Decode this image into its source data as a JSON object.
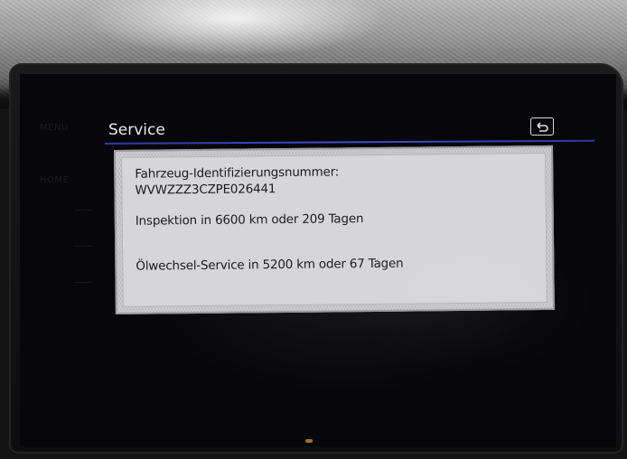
{
  "softkeys": {
    "menu": "MENU",
    "home": "HOME"
  },
  "header": {
    "title": "Service",
    "back_icon": "back-arrow-icon"
  },
  "service_info": {
    "vin_label": "Fahrzeug-Identifizierungsnummer:",
    "vin_value": "WVWZZZ3CZPE026441",
    "inspection": "Inspektion in 6600 km oder 209 Tagen",
    "oil_service": "Ölwechsel-Service in 5200 km oder 67 Tagen"
  },
  "colors": {
    "title_rule": "#3b4ecc",
    "panel_bg": "#d6d6d9",
    "screen_bg": "#07070a"
  }
}
